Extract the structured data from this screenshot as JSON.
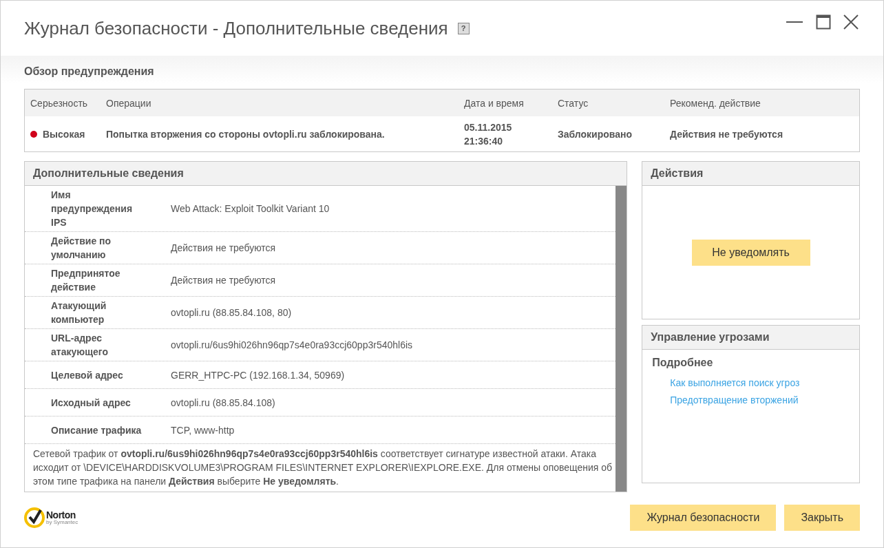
{
  "window": {
    "title": "Журнал безопасности - Дополнительные сведения",
    "help_label": "?"
  },
  "overview": {
    "heading": "Обзор предупреждения",
    "columns": [
      "Серьезность",
      "Операции",
      "Дата и время",
      "Статус",
      "Рекоменд. действие"
    ],
    "rows": [
      {
        "severity": "Высокая",
        "color": "#d0021b",
        "operation": "Попытка вторжения со стороны ovtopli.ru заблокирована.",
        "date": "05.11.2015",
        "time": "21:36:40",
        "status": "Заблокировано",
        "recommended": "Действия не требуются"
      }
    ]
  },
  "details": {
    "heading": "Дополнительные сведения",
    "rows": [
      {
        "label": "Имя предупреждения IPS",
        "value": "Web Attack: Exploit Toolkit Variant 10"
      },
      {
        "label": "Действие по умолчанию",
        "value": "Действия не требуются"
      },
      {
        "label": "Предпринятое действие",
        "value": "Действия не требуются"
      },
      {
        "label": "Атакующий компьютер",
        "value": "ovtopli.ru (88.85.84.108, 80)"
      },
      {
        "label": "URL-адрес атакующего",
        "value": "ovtopli.ru/6us9hi026hn96qp7s4e0ra93ccj60pp3r540hl6is"
      },
      {
        "label": "Целевой адрес",
        "value": "GERR_HTPC-PC (192.168.1.34, 50969)"
      },
      {
        "label": "Исходный адрес",
        "value": "ovtopli.ru (88.85.84.108)"
      },
      {
        "label": "Описание трафика",
        "value": "TCP, www-http"
      }
    ],
    "description": "Сетевой трафик от **ovtopli.ru/6us9hi026hn96qp7s4e0ra93ccj60pp3r540hl6is** соответствует сигнатуре известной атаки. Атака исходит от \\DEVICE\\HARDDISKVOLUME3\\PROGRAM FILES\\INTERNET EXPLORER\\IEXPLORE.EXE. Для отмены оповещения об этом типе трафика на панели **Действия** выберите **Не уведомлять**."
  },
  "actions": {
    "heading": "Действия",
    "button": "Не уведомлять"
  },
  "threat_management": {
    "heading": "Управление угрозами",
    "subheading": "Подробнее",
    "links": [
      "Как выполняется поиск угроз",
      "Предотвращение вторжений"
    ]
  },
  "logo": {
    "name": "Norton",
    "tagline": "by Symantec"
  },
  "buttons": [
    "Журнал безопасности",
    "Закрыть"
  ]
}
